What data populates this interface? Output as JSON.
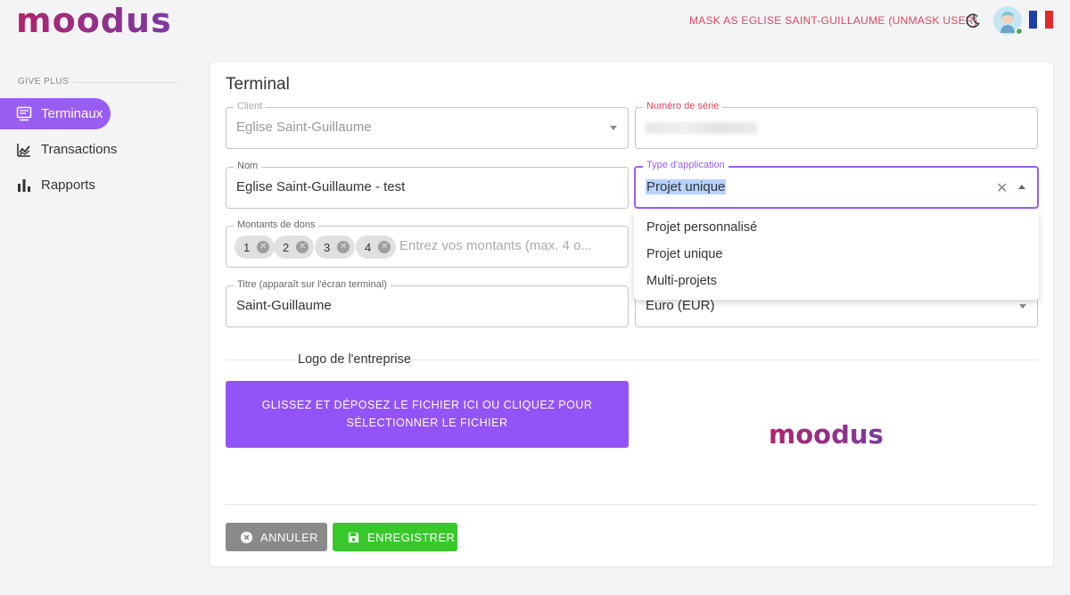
{
  "brand": {
    "logo_text": "moodus",
    "logo_color": "#9a2a7a"
  },
  "header": {
    "mask_text": "MASK AS EGLISE SAINT-GUILLAUME (UNMASK USER)",
    "theme_icon": "moon-icon",
    "language_flag": "france-flag-icon"
  },
  "sidebar": {
    "section_label": "GIVE PLUS",
    "items": [
      {
        "label": "Terminaux",
        "icon": "terminal-icon",
        "active": true
      },
      {
        "label": "Transactions",
        "icon": "chart-line-icon",
        "active": false
      },
      {
        "label": "Rapports",
        "icon": "bar-chart-icon",
        "active": false
      }
    ]
  },
  "form": {
    "title": "Terminal",
    "client": {
      "label": "Client",
      "value": "Eglise Saint-Guillaume"
    },
    "serial": {
      "label": "Numéro de série",
      "value": ""
    },
    "name": {
      "label": "Nom",
      "value": "Eglise Saint-Guillaume - test"
    },
    "app_type": {
      "label": "Type d'application",
      "value": "Projet unique",
      "options": [
        "Projet personnalisé",
        "Projet unique",
        "Multi-projets"
      ]
    },
    "amounts": {
      "label": "Montants de dons",
      "chips": [
        "1",
        "2",
        "3",
        "4"
      ],
      "placeholder": "Entrez vos montants (max. 4 o..."
    },
    "screen_title": {
      "label": "Titre (apparaît sur l'écran terminal)",
      "value": "Saint-Guillaume"
    },
    "currency": {
      "value": "Euro (EUR)"
    },
    "logo_section": "Logo de l'entreprise",
    "upload_line1": "GLISSEZ ET DÉPOSEZ LE FICHIER ICI OU CLIQUEZ POUR",
    "upload_line2": "SÉLECTIONNER LE FICHIER",
    "cancel_label": "ANNULER",
    "save_label": "ENREGISTRER"
  },
  "colors": {
    "accent": "#9a5df2",
    "save": "#37c92a",
    "cancel": "#8a8a8a",
    "mask": "#d9485f"
  }
}
